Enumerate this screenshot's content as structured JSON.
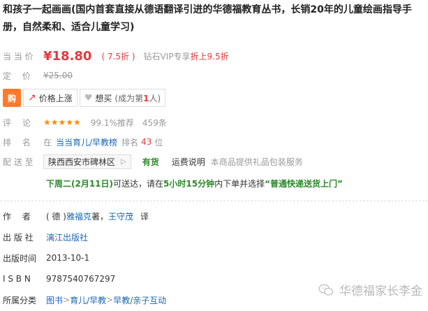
{
  "title": "和孩子一起画画(国内首套直接从德语翻译引进的华德福教育丛书，长销20年的儿童绘画指导手册，自然柔和、适合儿童学习)",
  "price": {
    "label": "当 当 价",
    "value": "¥18.80",
    "discount": "( 7.5折 )",
    "vip_prefix": "钻石VIP专享",
    "vip_offer": "折上9.5折",
    "list_label": "定　 价",
    "list_value": "¥25.00"
  },
  "actions": {
    "buy_icon": "购",
    "price_alert_label": "价格上涨",
    "wish_label": "想买",
    "wish_sub_prefix": "(成为第",
    "wish_sub_num": "1",
    "wish_sub_suffix": "人)"
  },
  "review": {
    "label": "评　 论",
    "stars": "★★★★★",
    "rate": "99.1%推荐",
    "count": "459条"
  },
  "rank": {
    "label": "排　 名",
    "prefix": "在",
    "category": "当当育儿/早教榜",
    "mid": "排名",
    "number": "43",
    "suffix": "位"
  },
  "shipping": {
    "label": "配 送 至",
    "region": "陕西西安市碑林区",
    "stock": "有货",
    "policy_link": "运费说明",
    "note": "本商品提供礼品包装服务"
  },
  "delivery": {
    "date": "下周二(2月11日)",
    "mid1": "可送达，请在",
    "time": "5小时15分钟",
    "mid2": "内下单并选择",
    "method": "“普通快递送货上门”"
  },
  "book_info": {
    "author_label": "作　 者",
    "author_prefix": "( 德 ) ",
    "author_name": "雅福克",
    "author_role": " 著，",
    "translator": "王守茂",
    "translator_role": "译",
    "publisher_label": "出 版 社",
    "publisher": "漓江出版社",
    "date_label": "出版时间",
    "date": "2013-10-1",
    "isbn_label": "I S B N",
    "isbn": "9787540767297",
    "category_label": "所属分类",
    "category_path": [
      "图书",
      "育儿/早教",
      "早教/亲子互动"
    ],
    "category_sep": " > "
  },
  "watermark": {
    "text": "华德福家长李金",
    "icon": "wechat-icon"
  },
  "colors": {
    "accent_red": "#e4393c",
    "link_blue": "#1a66b3",
    "stock_green": "#2a8a2a",
    "star_orange": "#ff8a00",
    "buy_orange": "#ff7a2a"
  }
}
